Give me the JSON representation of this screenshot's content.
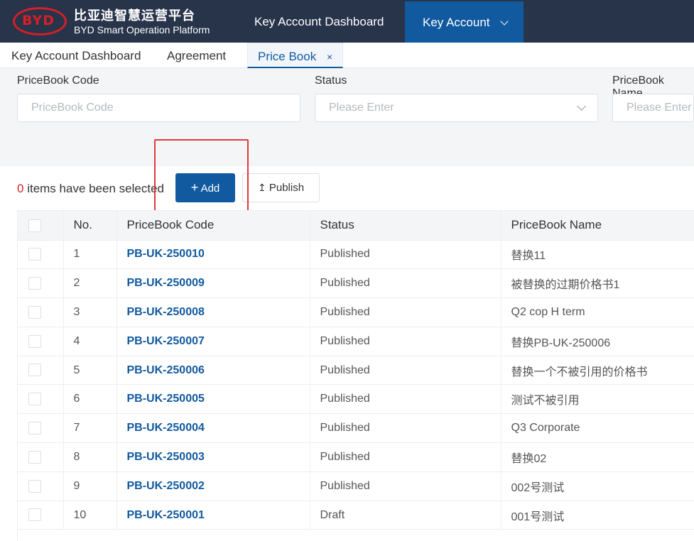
{
  "header": {
    "logo_text": "BYD",
    "brand_cn": "比亚迪智慧运营平台",
    "brand_en": "BYD Smart Operation Platform",
    "nav_dashboard": "Key Account Dashboard",
    "nav_account": "Key Account"
  },
  "tabs": [
    {
      "label": "Key Account Dashboard",
      "active": false
    },
    {
      "label": "Agreement",
      "active": false
    },
    {
      "label": "Price Book",
      "active": true,
      "close": "×"
    }
  ],
  "filters": [
    {
      "label": "PriceBook Code",
      "placeholder": "PriceBook Code"
    },
    {
      "label": "Status",
      "placeholder": "Please Enter",
      "type": "select"
    },
    {
      "label": "PriceBook Name",
      "placeholder": "Please Enter"
    }
  ],
  "selection": {
    "count": "0",
    "text": " items have been selected"
  },
  "actions": {
    "add_icon": "+",
    "add": "Add",
    "publish_icon": "↥",
    "publish": "Publish"
  },
  "table": {
    "columns": [
      "No.",
      "PriceBook Code",
      "Status",
      "PriceBook Name"
    ],
    "rows": [
      {
        "no": "1",
        "code": "PB-UK-250010",
        "status": "Published",
        "name": "替换11"
      },
      {
        "no": "2",
        "code": "PB-UK-250009",
        "status": "Published",
        "name": "被替换的过期价格书1"
      },
      {
        "no": "3",
        "code": "PB-UK-250008",
        "status": "Published",
        "name": "Q2 cop H term"
      },
      {
        "no": "4",
        "code": "PB-UK-250007",
        "status": "Published",
        "name": "替换PB-UK-250006"
      },
      {
        "no": "5",
        "code": "PB-UK-250006",
        "status": "Published",
        "name": "替换一个不被引用的价格书"
      },
      {
        "no": "6",
        "code": "PB-UK-250005",
        "status": "Published",
        "name": "测试不被引用"
      },
      {
        "no": "7",
        "code": "PB-UK-250004",
        "status": "Published",
        "name": "Q3 Corporate"
      },
      {
        "no": "8",
        "code": "PB-UK-250003",
        "status": "Published",
        "name": "替换02"
      },
      {
        "no": "9",
        "code": "PB-UK-250002",
        "status": "Published",
        "name": "002号测试"
      },
      {
        "no": "10",
        "code": "PB-UK-250001",
        "status": "Draft",
        "name": "001号测试"
      }
    ]
  },
  "colors": {
    "header_bg": "#27344a",
    "accent": "#125aa0",
    "brand_red": "#d61f26",
    "highlight": "#e0393e"
  }
}
